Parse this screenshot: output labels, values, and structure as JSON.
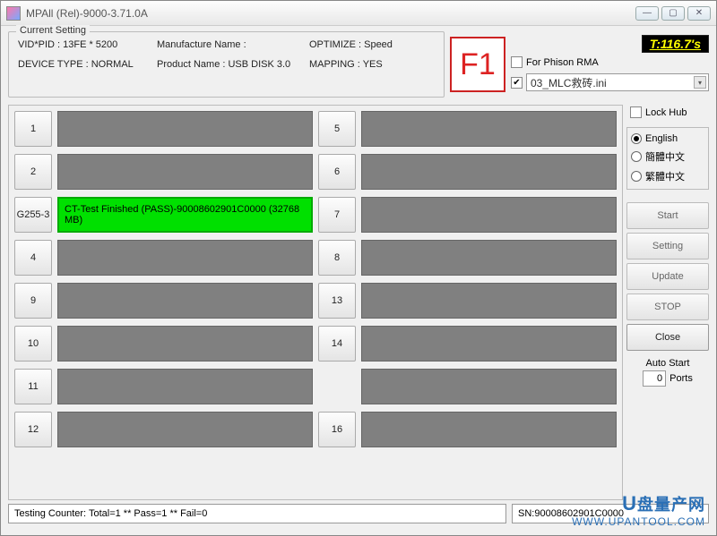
{
  "window": {
    "title": "MPAll (Rel)-9000-3.71.0A"
  },
  "current_setting": {
    "legend": "Current Setting",
    "vid_pid": "VID*PID : 13FE * 5200",
    "manu": "Manufacture Name :",
    "optimize": "OPTIMIZE : Speed",
    "devtype": "DEVICE TYPE : NORMAL",
    "product": "Product Name : USB DISK 3.0",
    "mapping": "MAPPING : YES"
  },
  "f1": "F1",
  "timer": "T:116.7's",
  "rma": {
    "label": "For Phison RMA",
    "checked": false
  },
  "ini": {
    "checked": true,
    "value": "03_MLC救砖.ini"
  },
  "lock_hub": {
    "label": "Lock Hub",
    "checked": false
  },
  "lang": {
    "options": [
      "English",
      "簡體中文",
      "繁體中文"
    ],
    "selected": 0
  },
  "buttons": {
    "start": "Start",
    "setting": "Setting",
    "update": "Update",
    "stop": "STOP",
    "close": "Close"
  },
  "autostart": {
    "label": "Auto Start",
    "value": "0",
    "suffix": "Ports"
  },
  "slots": [
    {
      "n": "1",
      "status": ""
    },
    {
      "n": "5",
      "status": ""
    },
    {
      "n": "2",
      "status": ""
    },
    {
      "n": "6",
      "status": ""
    },
    {
      "n": "G255-3",
      "status": "pass",
      "text": "CT-Test Finished (PASS)-90008602901C0000 (32768 MB)"
    },
    {
      "n": "7",
      "status": ""
    },
    {
      "n": "4",
      "status": ""
    },
    {
      "n": "8",
      "status": ""
    },
    {
      "n": "9",
      "status": ""
    },
    {
      "n": "13",
      "status": ""
    },
    {
      "n": "10",
      "status": ""
    },
    {
      "n": "14",
      "status": ""
    },
    {
      "n": "11",
      "status": ""
    },
    {
      "n": "",
      "status": "hidden"
    },
    {
      "n": "12",
      "status": ""
    },
    {
      "n": "16",
      "status": ""
    }
  ],
  "status": {
    "counter": "Testing Counter: Total=1 ** Pass=1 ** Fail=0",
    "sn": "SN:90008602901C0000"
  },
  "watermark": {
    "l1a": "U",
    "l1b": "盘量产网",
    "l2": "WWW.UPANTOOL.COM"
  }
}
